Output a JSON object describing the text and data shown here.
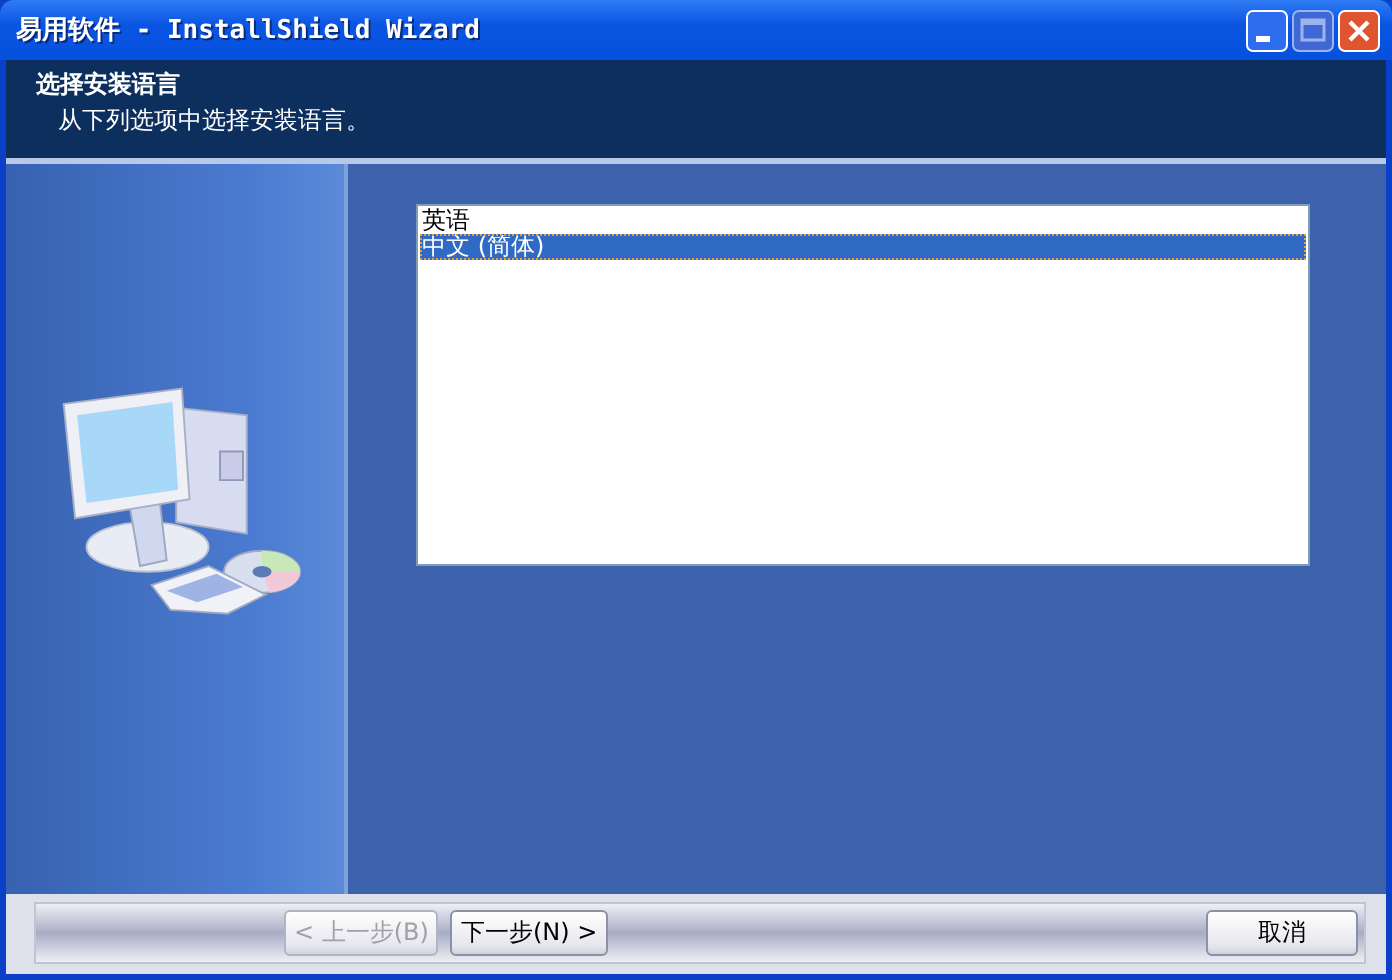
{
  "window": {
    "title": "易用软件 - InstallShield Wizard"
  },
  "header": {
    "title": "选择安装语言",
    "subtitle": "从下列选项中选择安装语言。"
  },
  "languages": [
    {
      "label": "英语",
      "selected": false
    },
    {
      "label": "中文 (简体)",
      "selected": true
    }
  ],
  "nav_buttons": [
    {
      "label": "< 上一步(B)",
      "disabled": true
    },
    {
      "label": "下一步(N) >",
      "disabled": false
    }
  ],
  "cancel_button": {
    "label": "取消",
    "disabled": false
  }
}
